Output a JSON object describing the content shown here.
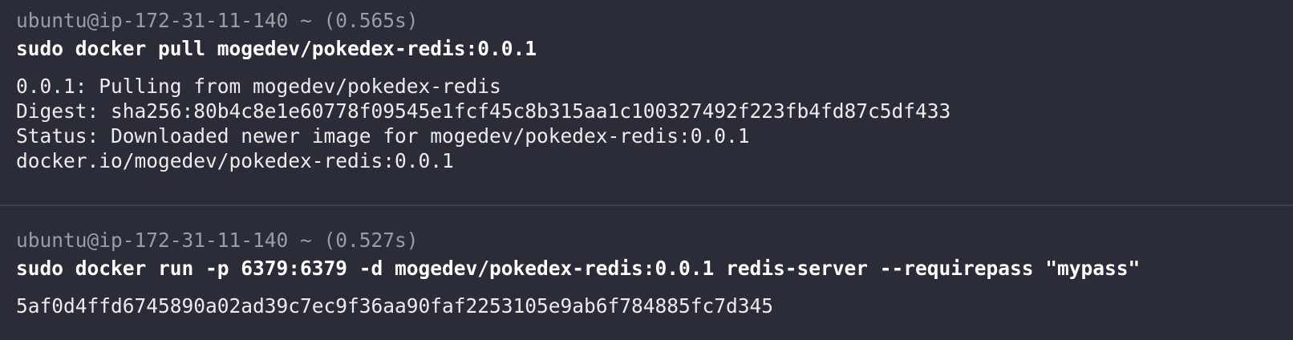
{
  "blocks": [
    {
      "prompt": "ubuntu@ip-172-31-11-140 ~ (0.565s)",
      "command": "sudo docker pull mogedev/pokedex-redis:0.0.1",
      "output": [
        "0.0.1: Pulling from mogedev/pokedex-redis",
        "Digest: sha256:80b4c8e1e60778f09545e1fcf45c8b315aa1c100327492f223fb4fd87c5df433",
        "Status: Downloaded newer image for mogedev/pokedex-redis:0.0.1",
        "docker.io/mogedev/pokedex-redis:0.0.1"
      ]
    },
    {
      "prompt": "ubuntu@ip-172-31-11-140 ~ (0.527s)",
      "command": "sudo docker run -p 6379:6379 -d mogedev/pokedex-redis:0.0.1 redis-server --requirepass \"mypass\"",
      "output": [
        "5af0d4ffd6745890a02ad39c7ec9f36aa90faf2253105e9ab6f784885fc7d345"
      ]
    }
  ]
}
